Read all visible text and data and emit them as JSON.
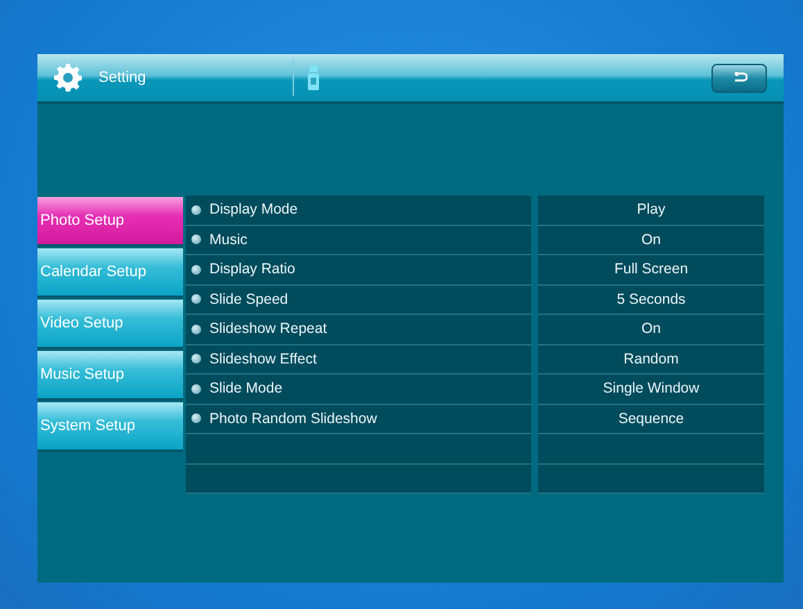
{
  "header": {
    "title": "Setting"
  },
  "menu": [
    {
      "label": "Photo Setup",
      "selected": true
    },
    {
      "label": "Calendar Setup",
      "selected": false
    },
    {
      "label": "Video Setup",
      "selected": false
    },
    {
      "label": "Music Setup",
      "selected": false
    },
    {
      "label": "System Setup",
      "selected": false
    }
  ],
  "settings": [
    {
      "name": "Display Mode",
      "value": "Play"
    },
    {
      "name": "Music",
      "value": "On"
    },
    {
      "name": "Display Ratio",
      "value": "Full Screen"
    },
    {
      "name": "Slide Speed",
      "value": "5 Seconds"
    },
    {
      "name": "Slideshow Repeat",
      "value": "On"
    },
    {
      "name": "Slideshow Effect",
      "value": "Random"
    },
    {
      "name": "Slide Mode",
      "value": "Single Window"
    },
    {
      "name": "Photo Random Slideshow",
      "value": "Sequence"
    }
  ]
}
